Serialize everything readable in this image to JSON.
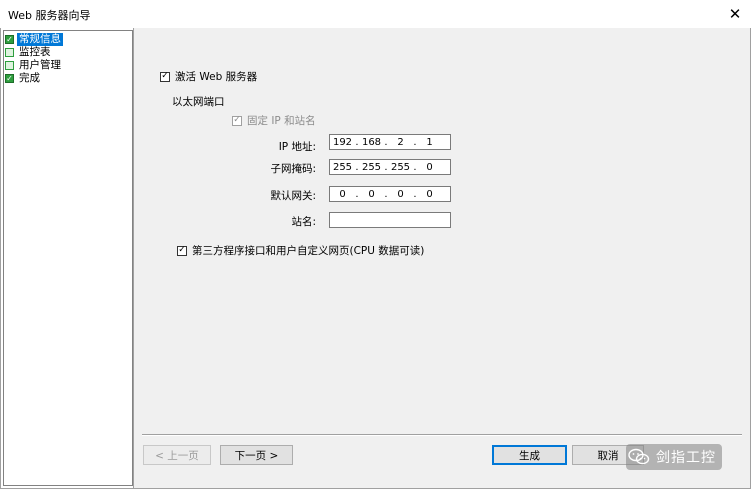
{
  "window": {
    "title": "Web 服务器向导"
  },
  "sidebar": {
    "items": [
      {
        "label": "常规信息",
        "state": "done",
        "selected": true
      },
      {
        "label": "监控表",
        "state": "todo",
        "selected": false
      },
      {
        "label": "用户管理",
        "state": "todo",
        "selected": false
      },
      {
        "label": "完成",
        "state": "done",
        "selected": false
      }
    ]
  },
  "form": {
    "activate_label": "激活 Web 服务器",
    "activate_checked": "✓",
    "ethernet_section": "以太网端口",
    "fixed_ip_label": "固定 IP 和站名",
    "fixed_ip_checked": "✓",
    "ip_label": "IP 地址:",
    "ip_value": [
      "192",
      "168",
      "2",
      "1"
    ],
    "subnet_label": "子网掩码:",
    "subnet_value": [
      "255",
      "255",
      "255",
      "0"
    ],
    "gateway_label": "默认网关:",
    "gateway_value": [
      "0",
      "0",
      "0",
      "0"
    ],
    "station_label": "站名:",
    "station_value": "",
    "thirdparty_label": "第三方程序接口和用户自定义网页(CPU 数据可读)",
    "thirdparty_checked": "✓",
    "dot": "."
  },
  "buttons": {
    "prev": "< 上一页",
    "next": "下一页 >",
    "generate": "生成",
    "cancel": "取消"
  },
  "watermark": {
    "text": "剑指工控"
  }
}
